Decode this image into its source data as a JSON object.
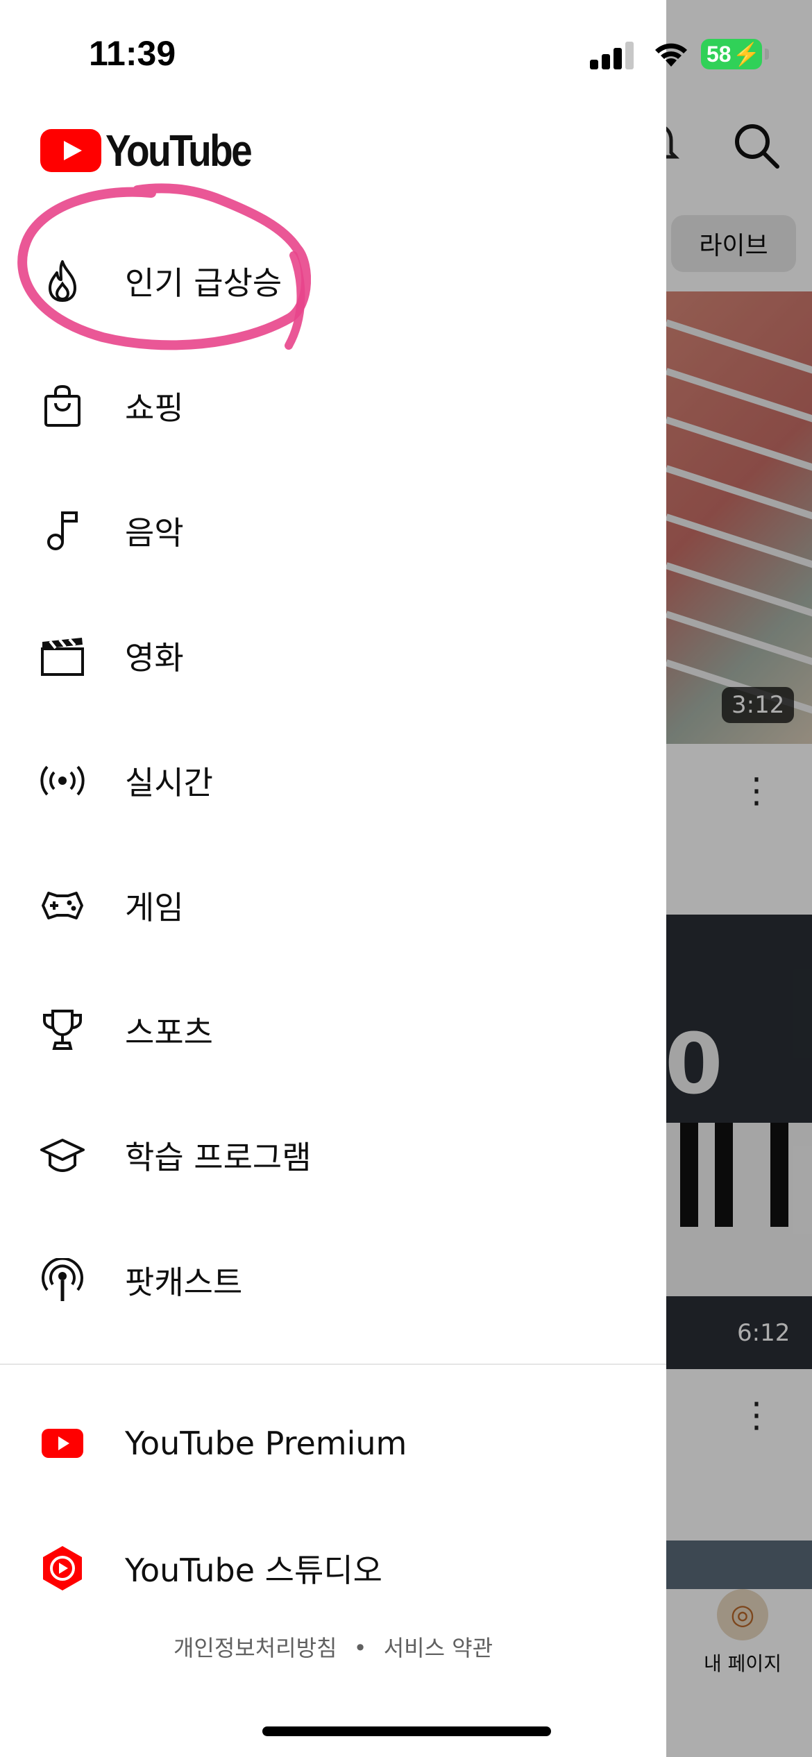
{
  "status_bar": {
    "time": "11:39",
    "battery": "58"
  },
  "drawer": {
    "logo_text": "YouTube",
    "items": [
      {
        "label": "인기 급상승",
        "icon": "trending-flame-icon"
      },
      {
        "label": "쇼핑",
        "icon": "shopping-bag-icon"
      },
      {
        "label": "음악",
        "icon": "music-note-icon"
      },
      {
        "label": "영화",
        "icon": "clapperboard-icon"
      },
      {
        "label": "실시간",
        "icon": "live-broadcast-icon"
      },
      {
        "label": "게임",
        "icon": "gamepad-icon"
      },
      {
        "label": "스포츠",
        "icon": "trophy-icon"
      },
      {
        "label": "학습 프로그램",
        "icon": "graduation-cap-icon"
      },
      {
        "label": "팟캐스트",
        "icon": "podcast-icon"
      }
    ],
    "more_items": [
      {
        "label": "YouTube Premium",
        "icon": "youtube-premium-icon"
      },
      {
        "label": "YouTube 스튜디오",
        "icon": "youtube-studio-icon"
      }
    ],
    "footer": {
      "privacy": "개인정보처리방침",
      "separator": "•",
      "terms": "서비스 약관"
    }
  },
  "background": {
    "chip_label": "라이브",
    "video1_duration": "3:12",
    "video2_duration": "6:12",
    "thumb2_text": "0",
    "nav_my_page": "내 페이지"
  },
  "colors": {
    "brand_red": "#ff0000",
    "annotation_pink": "#e8458b",
    "battery_green": "#30d158"
  }
}
